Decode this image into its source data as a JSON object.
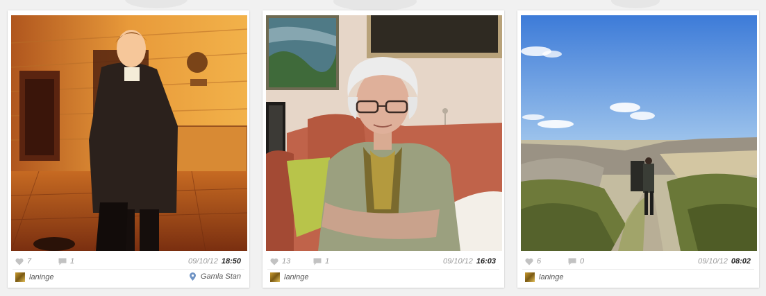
{
  "theme": {
    "icon_color": "#c2c2c2",
    "pin_color": "#6f93c4"
  },
  "posts": [
    {
      "photo_icon": "photo-man-in-coat-night-street",
      "likes": "7",
      "comments": "1",
      "date": "09/10/12",
      "time": "18:50",
      "username": "laninge",
      "location": "Gamla Stan"
    },
    {
      "photo_icon": "photo-elderly-woman-on-sofa",
      "likes": "13",
      "comments": "1",
      "date": "09/10/12",
      "time": "16:03",
      "username": "laninge"
    },
    {
      "photo_icon": "photo-hiker-on-coastal-path",
      "likes": "6",
      "comments": "0",
      "date": "09/10/12",
      "time": "08:02",
      "username": "laninge"
    }
  ]
}
